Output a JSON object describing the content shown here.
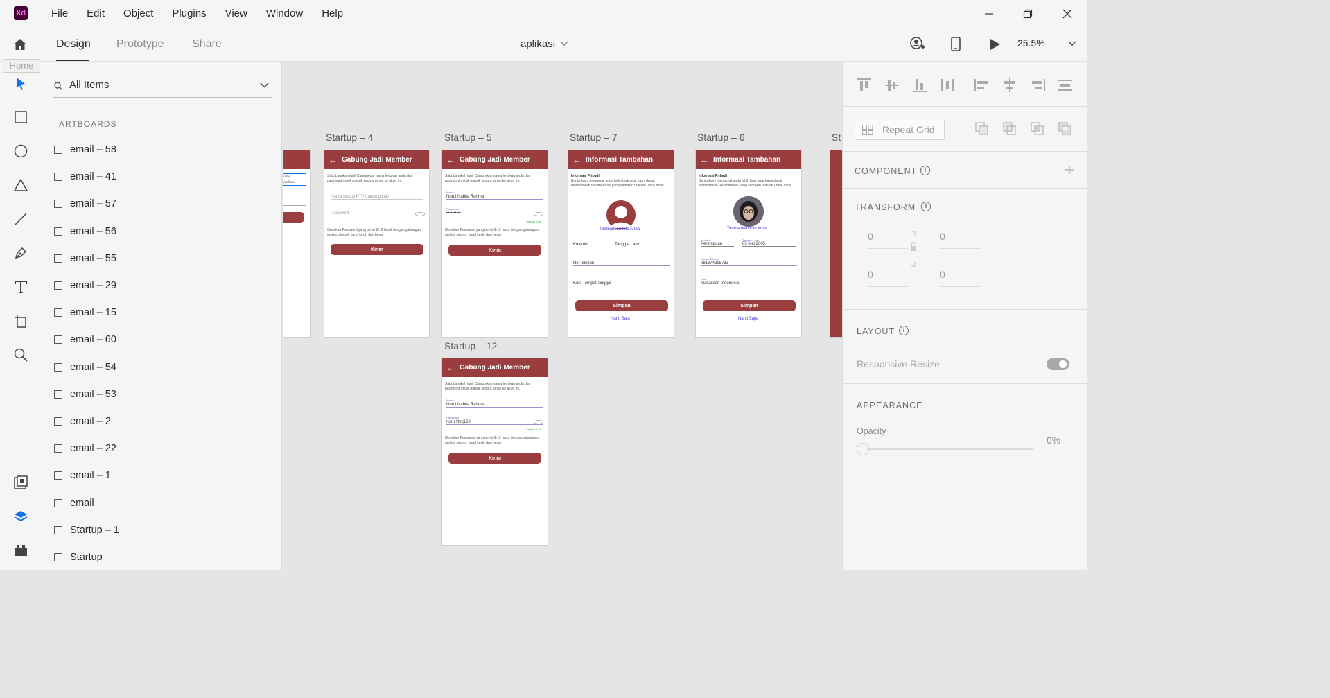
{
  "app": {
    "logo": "Xd"
  },
  "menu": [
    "File",
    "Edit",
    "Object",
    "Plugins",
    "View",
    "Window",
    "Help"
  ],
  "window_controls": {
    "minimize": "minimize-icon",
    "restore": "restore-icon",
    "close": "close-icon"
  },
  "tabs": {
    "design": "Design",
    "prototype": "Prototype",
    "share": "Share"
  },
  "document": {
    "title": "aplikasi"
  },
  "zoom": "25.5%",
  "tooltip": {
    "home": "Home"
  },
  "layers": {
    "search_label": "All Items",
    "section": "ARTBOARDS",
    "items": [
      "email – 58",
      "email – 41",
      "email – 57",
      "email – 56",
      "email – 55",
      "email – 29",
      "email – 15",
      "email – 60",
      "email – 54",
      "email – 53",
      "email – 2",
      "email – 22",
      "email – 1",
      "email",
      "Startup – 1",
      "Startup"
    ]
  },
  "canvas": {
    "partial_right_title": "St",
    "partial_left_fragments": [
      "ian kami",
      "ian verifikasi"
    ],
    "startup4": {
      "title": "Startup – 4",
      "header": "Gabung Jadi Member",
      "intro": "Satu Langkah lagi! Cantumkan nama lengkap anda dan password untuk masuk secara aman ke akun ini.",
      "name_placeholder": "Nama sesuai KTP (tanpa gelar)",
      "password_placeholder": "Password",
      "note": "Gunakan Password yang berisi 8-12 huruf dengan gabungan angka, simbol, huruf kecil, dan besar",
      "button": "Kirim"
    },
    "startup5": {
      "title": "Startup – 5",
      "header": "Gabung Jadi Member",
      "intro": "Satu Langkah lagi! Cantumkan nama lengkap anda dan password untuk masuk secara aman ke akun ini.",
      "name_hint": "Nama",
      "name_value": "Nurul Nabila Rahma",
      "password_hint": "Password",
      "password_value": "••••••••••",
      "strength": "Sangat Kuat",
      "note": "Gunakan Password yang berisi 8-12 huruf dengan gabungan angka, simbol, huruf kecil, dan besar",
      "button": "Kirim"
    },
    "startup7": {
      "title": "Startup – 7",
      "header": "Informasi Tambahan",
      "heading": "Informasi Pribadi",
      "intro": "Bantu kami mengenal anda lebih baik agar kami dapat memberikan rekomendasi yang semakin relevan untuk anda",
      "photo_link": "Tambahkan foto Anda",
      "gender": "Kelamin",
      "dob": "Tanggal Lahir",
      "phone": "No.Telepon",
      "city": "Kota Tempat Tinggal",
      "button": "Simpan",
      "later": "Nanti Saja"
    },
    "startup6": {
      "title": "Startup – 6",
      "header": "Informasi Tambahan",
      "heading": "Informasi Pribadi",
      "intro": "Bantu kami mengenal anda lebih baik agar kami dapat memberikan rekomendasi yang semakin relevan untuk anda",
      "photo_link": "Tambahkan foto Anda",
      "gender_hint": "Kelamin",
      "gender_value": "Perempuan",
      "dob_hint": "Tanggal Lahir",
      "dob_value": "05 Mei 2005",
      "phone_hint": "Nomor Telepon",
      "phone_value": "081874398733",
      "city_hint": "Kota",
      "city_value": "Makassar, Indonesia",
      "button": "Simpan",
      "later": "Nanti Saja"
    },
    "startup12": {
      "title": "Startup – 12",
      "header": "Gabung Jadi Member",
      "intro": "Satu Langkah lagi! Cantumkan nama lengkap anda dan password untuk masuk secara aman ke akun ini.",
      "name_hint": "Nama",
      "name_value": "Nurul Nabila Rahma",
      "password_hint": "Password",
      "password_value": "nurul!!tmj123",
      "strength": "Sangat Kuat",
      "note": "Gunakan Password yang berisi 8-12 huruf dengan gabungan angka, simbol, huruf kecil, dan besar",
      "button": "Kirim"
    }
  },
  "inspector": {
    "repeat_grid": "Repeat Grid",
    "component": "COMPONENT",
    "transform": "TRANSFORM",
    "transform_values": {
      "w": "0",
      "h": "0",
      "x": "0",
      "y": "0"
    },
    "layout": "LAYOUT",
    "responsive_resize": "Responsive Resize",
    "appearance": "APPEARANCE",
    "opacity_label": "Opacity",
    "opacity_value": "0%"
  },
  "colors": {
    "accent": "#993d3f",
    "brand": "#470137",
    "link": "#3b39d6",
    "selection": "#1473e6"
  }
}
